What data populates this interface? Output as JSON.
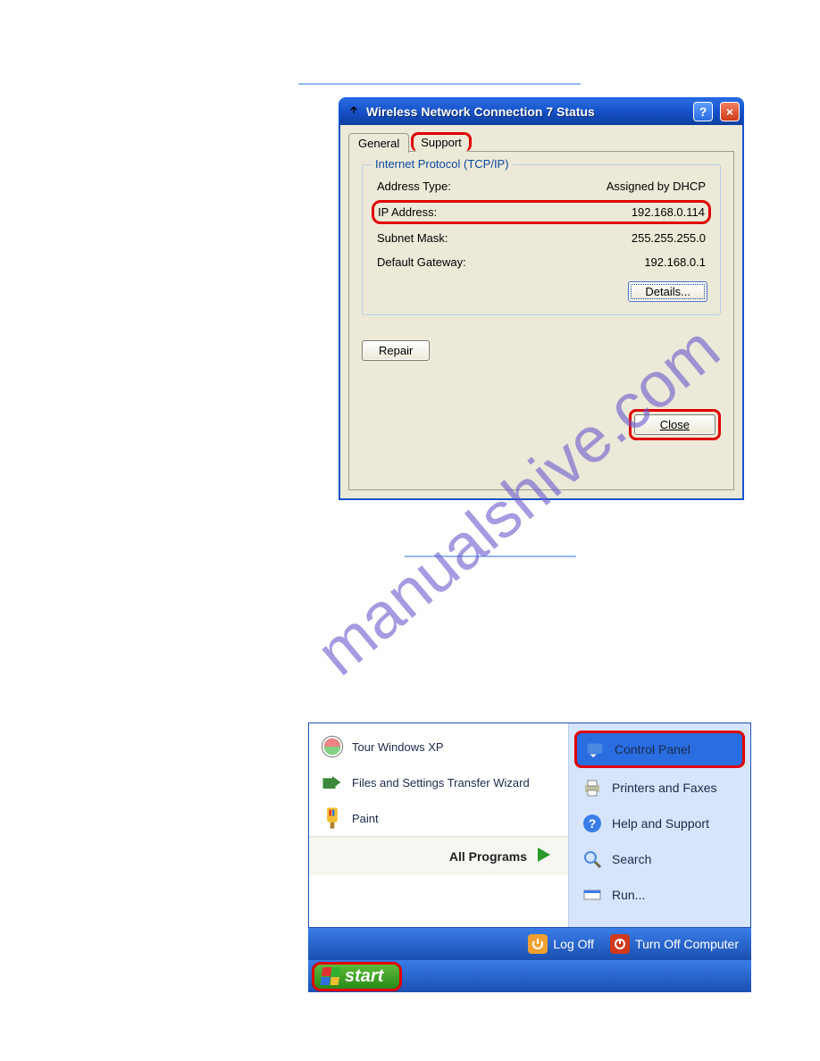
{
  "watermark": "manualshive.com",
  "dialog": {
    "title": "Wireless Network Connection 7 Status",
    "tabs": {
      "general": "General",
      "support": "Support"
    },
    "group_title": "Internet Protocol (TCP/IP)",
    "rows": {
      "addr_type_lbl": "Address Type:",
      "addr_type_val": "Assigned by DHCP",
      "ip_lbl": "IP Address:",
      "ip_val": "192.168.0.114",
      "subnet_lbl": "Subnet Mask:",
      "subnet_val": "255.255.255.0",
      "gateway_lbl": "Default Gateway:",
      "gateway_val": "192.168.0.1"
    },
    "buttons": {
      "details": "Details...",
      "repair": "Repair",
      "close": "Close"
    }
  },
  "startmenu": {
    "left": {
      "tour": "Tour Windows XP",
      "fst": "Files and Settings Transfer Wizard",
      "paint": "Paint",
      "allprograms": "All Programs"
    },
    "right": {
      "control_panel": "Control Panel",
      "printers": "Printers and Faxes",
      "help": "Help and Support",
      "search": "Search",
      "run": "Run..."
    },
    "footer": {
      "logoff": "Log Off",
      "turnoff": "Turn Off Computer"
    },
    "start": "start"
  }
}
